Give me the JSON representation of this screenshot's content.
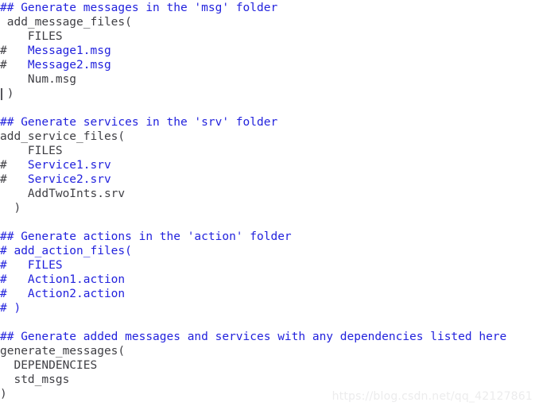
{
  "editor": {
    "background_color": "#ffffff",
    "comment_color": "#2222dd",
    "code_color": "#3f3f44",
    "caret_color": "#55555c",
    "caret_line_index": 6
  },
  "watermark": {
    "text": "https://blog.csdn.net/qq_42127861",
    "color": "#ececed"
  },
  "code": {
    "lines": [
      {
        "index": 0,
        "text": "## Generate messages in the 'msg' folder",
        "kind": "comment"
      },
      {
        "index": 1,
        "text": " add_message_files(",
        "kind": "code"
      },
      {
        "index": 2,
        "text": "    FILES",
        "kind": "code"
      },
      {
        "index": 3,
        "hash": "#",
        "text": "   Message1.msg",
        "kind": "hash-comment"
      },
      {
        "index": 4,
        "hash": "#",
        "text": "   Message2.msg",
        "kind": "hash-comment"
      },
      {
        "index": 5,
        "text": "    Num.msg",
        "kind": "code"
      },
      {
        "index": 6,
        "text": " )",
        "kind": "code"
      },
      {
        "index": 7,
        "text": "",
        "kind": "blank"
      },
      {
        "index": 8,
        "text": "## Generate services in the 'srv' folder",
        "kind": "comment"
      },
      {
        "index": 9,
        "text": "add_service_files(",
        "kind": "code"
      },
      {
        "index": 10,
        "text": "    FILES",
        "kind": "code"
      },
      {
        "index": 11,
        "hash": "#",
        "text": "   Service1.srv",
        "kind": "hash-comment"
      },
      {
        "index": 12,
        "hash": "#",
        "text": "   Service2.srv",
        "kind": "hash-comment"
      },
      {
        "index": 13,
        "text": "    AddTwoInts.srv",
        "kind": "code"
      },
      {
        "index": 14,
        "text": "  )",
        "kind": "code"
      },
      {
        "index": 15,
        "text": "",
        "kind": "blank"
      },
      {
        "index": 16,
        "text": "## Generate actions in the 'action' folder",
        "kind": "comment"
      },
      {
        "index": 17,
        "text": "# add_action_files(",
        "kind": "comment"
      },
      {
        "index": 18,
        "text": "#   FILES",
        "kind": "comment"
      },
      {
        "index": 19,
        "text": "#   Action1.action",
        "kind": "comment"
      },
      {
        "index": 20,
        "text": "#   Action2.action",
        "kind": "comment"
      },
      {
        "index": 21,
        "text": "# )",
        "kind": "comment"
      },
      {
        "index": 22,
        "text": "",
        "kind": "blank"
      },
      {
        "index": 23,
        "text": "## Generate added messages and services with any dependencies listed here",
        "kind": "comment"
      },
      {
        "index": 24,
        "text": "generate_messages(",
        "kind": "code"
      },
      {
        "index": 25,
        "text": "  DEPENDENCIES",
        "kind": "code"
      },
      {
        "index": 26,
        "text": "  std_msgs",
        "kind": "code"
      },
      {
        "index": 27,
        "text": ")",
        "kind": "code"
      }
    ]
  }
}
